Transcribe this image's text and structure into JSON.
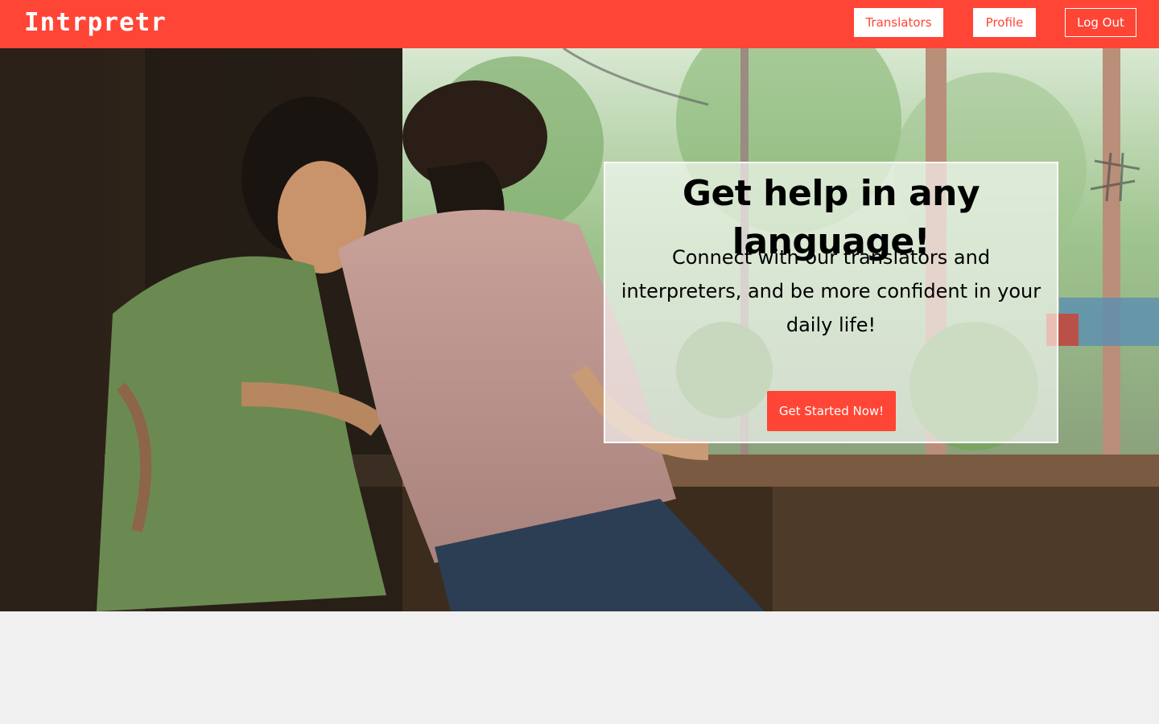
{
  "navbar": {
    "logo": "Intrpretr",
    "links": [
      {
        "label": "Translators"
      },
      {
        "label": "Profile"
      },
      {
        "label": "Log Out"
      }
    ]
  },
  "hero": {
    "image": "photo of two women sitting at a window counter",
    "title": "Get help in any language!",
    "subtitle": "Connect with our translators and interpreters, and be more confident in your daily life!",
    "cta_label": "Get Started Now!"
  },
  "colors": {
    "accent": "#fe4536",
    "page_background": "#f0f0f0",
    "card_background": "#ffffff"
  }
}
